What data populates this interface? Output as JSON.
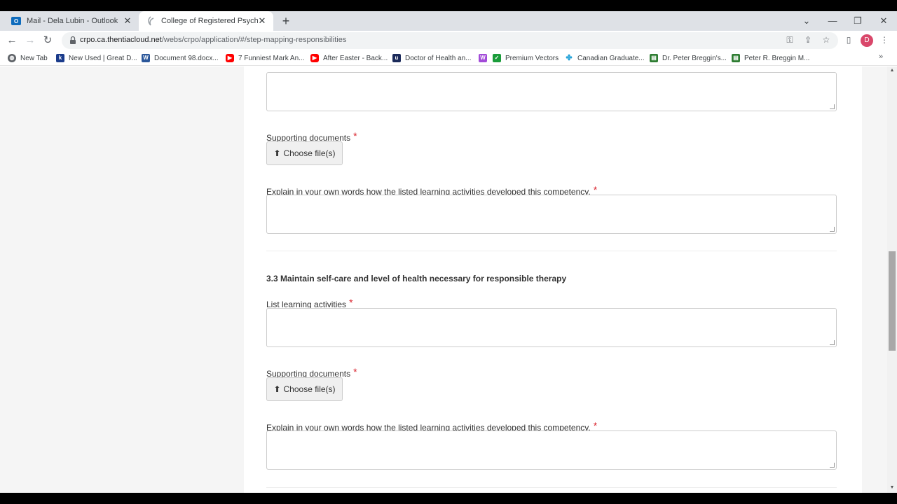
{
  "tabs": [
    {
      "title": "Mail - Dela Lubin - Outlook",
      "favicon": "outlook-icon",
      "color": "#0f6cbd"
    },
    {
      "title": "College of Registered Psychothe",
      "favicon": "crpo-icon",
      "color": "#9aa0a6"
    }
  ],
  "address": {
    "host": "crpo.ca.thentiacloud.net",
    "path": "/webs/crpo/application/#/step-mapping-responsibilities"
  },
  "profile": {
    "initial": "D"
  },
  "bookmarks": [
    {
      "label": "New Tab",
      "icon": "globe-icon",
      "color": "#5f6368"
    },
    {
      "label": "New Used | Great D...",
      "icon": "k-icon",
      "color": "#1a3b8b"
    },
    {
      "label": "Document 98.docx...",
      "icon": "word-icon",
      "color": "#2b579a"
    },
    {
      "label": "7 Funniest Mark An...",
      "icon": "youtube-icon",
      "color": "#ff0000"
    },
    {
      "label": "After Easter - Back...",
      "icon": "youtube-icon",
      "color": "#ff0000"
    },
    {
      "label": "Doctor of Health an...",
      "icon": "university-icon",
      "color": "#1b2a5a"
    },
    {
      "label": "",
      "icon": "w-icon",
      "color": "#a24bd8"
    },
    {
      "label": "Premium Vectors",
      "icon": "check-icon",
      "color": "#1a9c3a"
    },
    {
      "label": "Canadian Graduate...",
      "icon": "maple-icon",
      "color": "#26a3d9"
    },
    {
      "label": "Dr. Peter Breggin's...",
      "icon": "doc-icon",
      "color": "#2e7d32"
    },
    {
      "label": "Peter R. Breggin M...",
      "icon": "doc-icon",
      "color": "#2e7d32"
    }
  ],
  "form": {
    "supporting_documents_label": "Supporting documents",
    "choose_files_label": "Choose file(s)",
    "explain_label": "Explain in your own words how the listed learning activities developed this competency.",
    "section_heading": "3.3 Maintain self-care and level of health necessary for responsible therapy",
    "list_activities_label": "List learning activities",
    "required_mark": "*"
  }
}
